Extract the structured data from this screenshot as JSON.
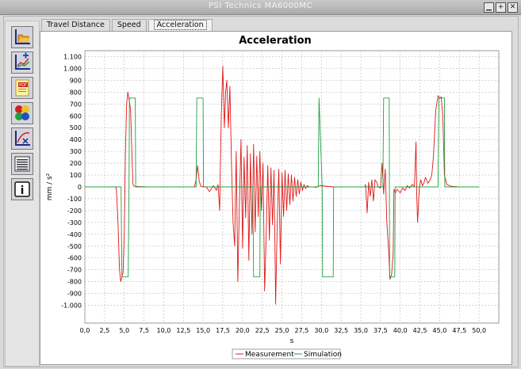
{
  "window": {
    "title": "PSI Technics MA6000MC",
    "controls": [
      "minimize-icon",
      "maximize-icon",
      "close-icon"
    ]
  },
  "toolbar": {
    "buttons": [
      {
        "name": "open-folder-button",
        "icon": "folder-open-icon"
      },
      {
        "name": "add-chart-button",
        "icon": "chart-add-icon"
      },
      {
        "name": "export-pdf-button",
        "icon": "pdf-icon",
        "label": "PDF"
      },
      {
        "name": "signals-button",
        "icon": "traffic-light-icon"
      },
      {
        "name": "graph-x-button",
        "icon": "graph-x-icon"
      },
      {
        "name": "list-button",
        "icon": "list-icon"
      },
      {
        "name": "info-button",
        "icon": "info-icon",
        "label": "i"
      }
    ]
  },
  "tabs": [
    {
      "label": "Travel Distance",
      "active": false
    },
    {
      "label": "Speed",
      "active": false
    },
    {
      "label": "Acceleration",
      "active": true
    }
  ],
  "colors": {
    "measurement": "#e01818",
    "simulation": "#20a040",
    "grid": "#bdbdbd"
  },
  "chart_data": {
    "type": "line",
    "title": "Acceleration",
    "xlabel": "s",
    "ylabel": "mm / s²",
    "xlim": [
      0,
      52.5
    ],
    "ylim": [
      -1150,
      1150
    ],
    "xticks": [
      "0,0",
      "2,5",
      "5,0",
      "7,5",
      "10,0",
      "12,5",
      "15,0",
      "17,5",
      "20,0",
      "22,5",
      "25,0",
      "27,5",
      "30,0",
      "32,5",
      "35,0",
      "37,5",
      "40,0",
      "42,5",
      "45,0",
      "47,5",
      "50,0"
    ],
    "yticks": [
      "1.100",
      "1.000",
      "900",
      "800",
      "700",
      "600",
      "500",
      "400",
      "300",
      "200",
      "100",
      "0",
      "-100",
      "-200",
      "-300",
      "-400",
      "-500",
      "-600",
      "-700",
      "-800",
      "-900",
      "-1.000"
    ],
    "grid": true,
    "legend_position": "bottom",
    "series": [
      {
        "name": "Measurement",
        "color": "#e01818",
        "points": [
          [
            0,
            0
          ],
          [
            3.9,
            0
          ],
          [
            4.0,
            -20
          ],
          [
            4.2,
            -300
          ],
          [
            4.4,
            -700
          ],
          [
            4.55,
            -800
          ],
          [
            4.7,
            -760
          ],
          [
            4.85,
            -720
          ],
          [
            5.0,
            -400
          ],
          [
            5.15,
            300
          ],
          [
            5.3,
            700
          ],
          [
            5.45,
            800
          ],
          [
            5.6,
            740
          ],
          [
            5.8,
            650
          ],
          [
            6.0,
            200
          ],
          [
            6.1,
            20
          ],
          [
            6.3,
            5
          ],
          [
            8,
            0
          ],
          [
            13.9,
            0
          ],
          [
            14.1,
            60
          ],
          [
            14.3,
            180
          ],
          [
            14.5,
            50
          ],
          [
            14.7,
            5
          ],
          [
            15.4,
            0
          ],
          [
            15.8,
            -40
          ],
          [
            16.3,
            10
          ],
          [
            16.7,
            -30
          ],
          [
            16.9,
            20
          ],
          [
            17.1,
            -200
          ],
          [
            17.3,
            600
          ],
          [
            17.5,
            1020
          ],
          [
            17.7,
            500
          ],
          [
            17.85,
            800
          ],
          [
            18.0,
            900
          ],
          [
            18.2,
            500
          ],
          [
            18.4,
            850
          ],
          [
            18.6,
            200
          ],
          [
            18.8,
            -300
          ],
          [
            19.0,
            -500
          ],
          [
            19.2,
            300
          ],
          [
            19.4,
            -800
          ],
          [
            19.6,
            -150
          ],
          [
            19.8,
            400
          ],
          [
            20.0,
            -520
          ],
          [
            20.2,
            250
          ],
          [
            20.4,
            -260
          ],
          [
            20.6,
            350
          ],
          [
            20.8,
            -620
          ],
          [
            21.0,
            280
          ],
          [
            21.2,
            -400
          ],
          [
            21.4,
            360
          ],
          [
            21.6,
            -380
          ],
          [
            21.8,
            260
          ],
          [
            22.0,
            -250
          ],
          [
            22.2,
            300
          ],
          [
            22.4,
            -200
          ],
          [
            22.6,
            200
          ],
          [
            22.8,
            -880
          ],
          [
            23.0,
            -400
          ],
          [
            23.2,
            180
          ],
          [
            23.4,
            -450
          ],
          [
            23.6,
            160
          ],
          [
            23.8,
            -320
          ],
          [
            24.0,
            140
          ],
          [
            24.2,
            -990
          ],
          [
            24.4,
            -300
          ],
          [
            24.6,
            150
          ],
          [
            24.8,
            -650
          ],
          [
            25.0,
            120
          ],
          [
            25.2,
            -250
          ],
          [
            25.4,
            140
          ],
          [
            25.6,
            -200
          ],
          [
            25.8,
            110
          ],
          [
            26.0,
            -150
          ],
          [
            26.2,
            100
          ],
          [
            26.4,
            -120
          ],
          [
            26.6,
            80
          ],
          [
            26.8,
            -80
          ],
          [
            27.0,
            60
          ],
          [
            27.2,
            -60
          ],
          [
            27.4,
            40
          ],
          [
            27.6,
            -30
          ],
          [
            27.8,
            20
          ],
          [
            28.0,
            -15
          ],
          [
            28.2,
            10
          ],
          [
            28.5,
            0
          ],
          [
            29.0,
            0
          ],
          [
            29.3,
            -5
          ],
          [
            29.8,
            10
          ],
          [
            31.5,
            0
          ],
          [
            35.5,
            0
          ],
          [
            35.6,
            20
          ],
          [
            35.8,
            -220
          ],
          [
            36.0,
            40
          ],
          [
            36.2,
            -80
          ],
          [
            36.4,
            60
          ],
          [
            36.6,
            -120
          ],
          [
            36.8,
            60
          ],
          [
            37.0,
            40
          ],
          [
            37.2,
            0
          ],
          [
            37.5,
            -10
          ],
          [
            37.7,
            200
          ],
          [
            37.9,
            -60
          ],
          [
            38.1,
            150
          ],
          [
            38.3,
            -300
          ],
          [
            38.5,
            -500
          ],
          [
            38.7,
            -780
          ],
          [
            38.9,
            -740
          ],
          [
            39.1,
            -560
          ],
          [
            39.2,
            -20
          ],
          [
            39.4,
            -50
          ],
          [
            39.6,
            -20
          ],
          [
            40.0,
            -50
          ],
          [
            40.3,
            -10
          ],
          [
            40.6,
            -30
          ],
          [
            40.9,
            10
          ],
          [
            41.2,
            -10
          ],
          [
            41.5,
            20
          ],
          [
            41.8,
            5
          ],
          [
            42.0,
            380
          ],
          [
            42.1,
            -80
          ],
          [
            42.2,
            -300
          ],
          [
            42.4,
            -20
          ],
          [
            42.6,
            60
          ],
          [
            42.8,
            10
          ],
          [
            43.0,
            30
          ],
          [
            43.2,
            80
          ],
          [
            43.5,
            30
          ],
          [
            43.8,
            60
          ],
          [
            44.0,
            100
          ],
          [
            44.2,
            250
          ],
          [
            44.5,
            650
          ],
          [
            44.8,
            770
          ],
          [
            45.0,
            750
          ],
          [
            45.2,
            760
          ],
          [
            45.4,
            600
          ],
          [
            45.6,
            100
          ],
          [
            45.9,
            20
          ],
          [
            46.5,
            5
          ],
          [
            47.5,
            0
          ],
          [
            50,
            0
          ]
        ]
      },
      {
        "name": "Simulation",
        "color": "#20a040",
        "points": [
          [
            0,
            0
          ],
          [
            4.6,
            0
          ],
          [
            4.7,
            -760
          ],
          [
            5.5,
            -760
          ],
          [
            5.6,
            0
          ],
          [
            5.65,
            750
          ],
          [
            6.4,
            750
          ],
          [
            6.45,
            0
          ],
          [
            14.1,
            0
          ],
          [
            14.2,
            750
          ],
          [
            15.0,
            750
          ],
          [
            15.05,
            0
          ],
          [
            21.3,
            0
          ],
          [
            21.4,
            -760
          ],
          [
            22.2,
            -760
          ],
          [
            22.25,
            0
          ],
          [
            29.6,
            0
          ],
          [
            29.7,
            750
          ],
          [
            30.1,
            0
          ],
          [
            30.15,
            -760
          ],
          [
            31.5,
            -760
          ],
          [
            31.55,
            0
          ],
          [
            37.8,
            0
          ],
          [
            37.9,
            750
          ],
          [
            38.6,
            750
          ],
          [
            38.65,
            -760
          ],
          [
            39.3,
            -760
          ],
          [
            39.35,
            0
          ],
          [
            44.8,
            0
          ],
          [
            44.9,
            750
          ],
          [
            45.6,
            750
          ],
          [
            45.65,
            0
          ],
          [
            50,
            0
          ]
        ]
      }
    ]
  }
}
